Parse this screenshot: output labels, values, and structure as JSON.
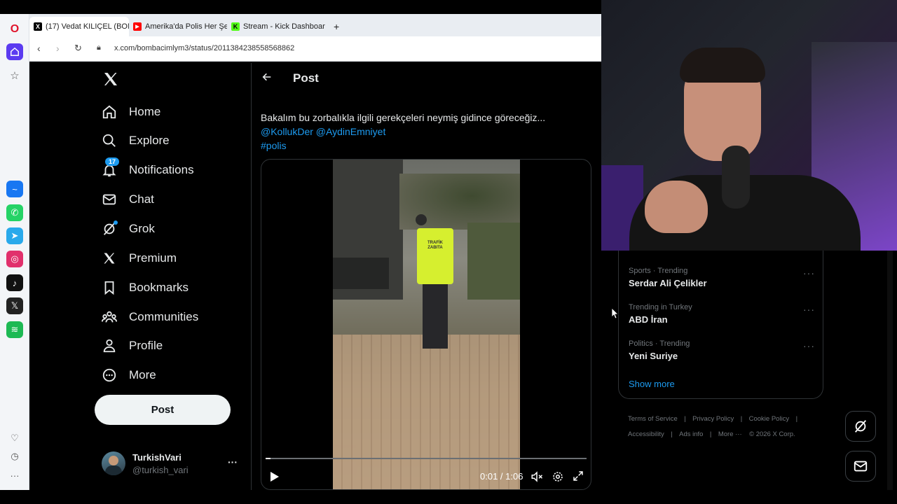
{
  "browser": {
    "tabs": [
      {
        "label": "(17) Vedat KILIÇEL (BOMB...",
        "favicon": "X"
      },
      {
        "label": "Amerika'da Polis Her Şeyi...",
        "favicon": "▶"
      },
      {
        "label": "Stream - Kick Dashboard",
        "favicon": "K"
      }
    ],
    "new_tab": "+",
    "url": "x.com/bombacimlym3/status/2011384238558568862"
  },
  "sidebar_apps": [
    "messenger-icon",
    "whatsapp-icon",
    "telegram-icon",
    "instagram-icon",
    "tiktok-icon",
    "x-icon",
    "spotify-icon"
  ],
  "nav": {
    "items": [
      {
        "label": "Home",
        "icon": "home-icon"
      },
      {
        "label": "Explore",
        "icon": "search-icon"
      },
      {
        "label": "Notifications",
        "icon": "bell-icon",
        "badge": "17"
      },
      {
        "label": "Chat",
        "icon": "mail-icon"
      },
      {
        "label": "Grok",
        "icon": "grok-icon"
      },
      {
        "label": "Premium",
        "icon": "x-logo-icon"
      },
      {
        "label": "Bookmarks",
        "icon": "bookmark-icon"
      },
      {
        "label": "Communities",
        "icon": "people-icon"
      },
      {
        "label": "Profile",
        "icon": "person-icon"
      },
      {
        "label": "More",
        "icon": "more-circle-icon"
      }
    ],
    "post_button": "Post",
    "account": {
      "name": "TurkishVari",
      "handle": "@turkish_vari",
      "more": "···"
    }
  },
  "post": {
    "header": "Post",
    "text": "Bakalım bu zorbalıkla ilgili gerekçeleri neymiş gidince göreceğiz...",
    "mentions": "@KollukDer @AydinEmniyet",
    "hashtag": "#polis",
    "video": {
      "time": "0:01 / 1:06",
      "progress": 0.015,
      "vest_text": "TRAFİK\nZABITA"
    }
  },
  "trends": [
    {
      "category": "Sports · Trending",
      "name": "Serdar Ali Çelikler"
    },
    {
      "category": "Trending in Turkey",
      "name": "ABD İran"
    },
    {
      "category": "Politics · Trending",
      "name": "Yeni Suriye"
    }
  ],
  "show_more": "Show more",
  "footer": {
    "links": [
      "Terms of Service",
      "Privacy Policy",
      "Cookie Policy",
      "Accessibility",
      "Ads info",
      "More ···"
    ],
    "separator": "|",
    "copyright": "© 2026 X Corp."
  },
  "colors": {
    "accent": "#1d9bf0",
    "bg": "#000000",
    "text": "#e7e9ea",
    "muted": "#71767b"
  }
}
